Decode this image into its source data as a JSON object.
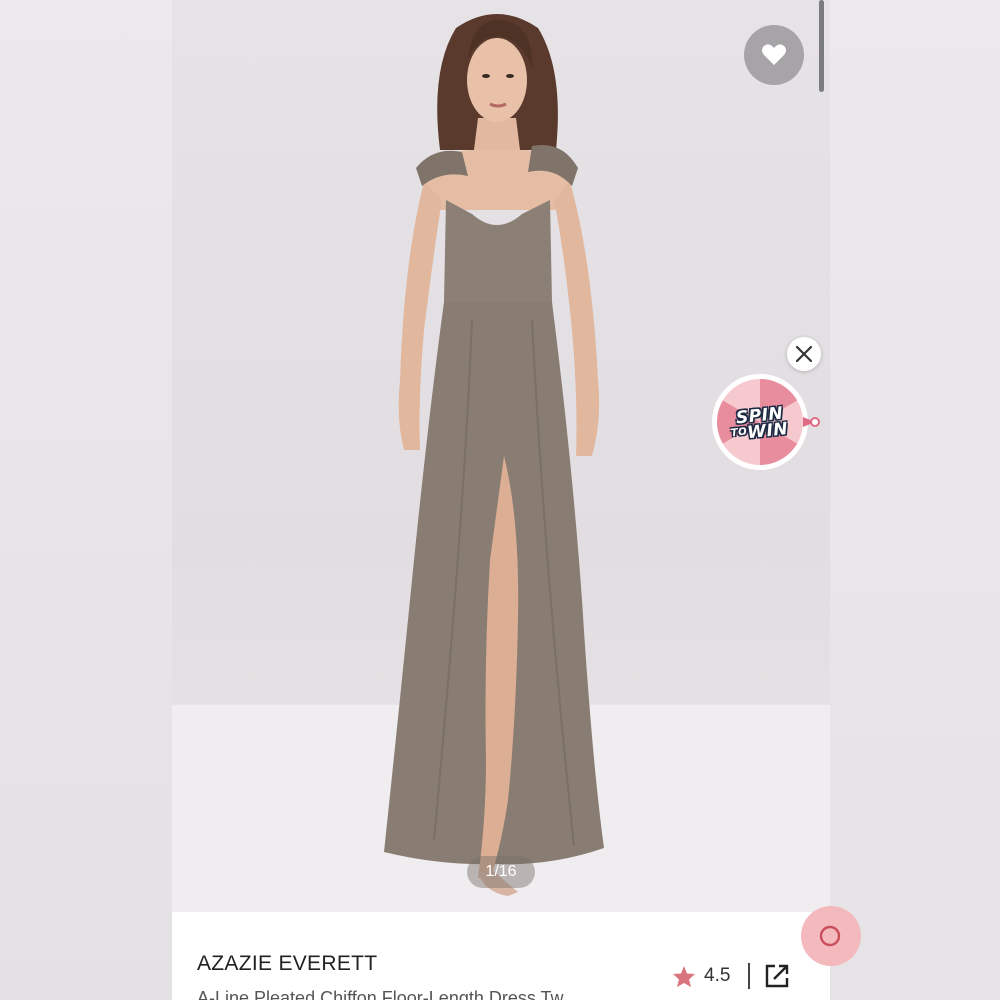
{
  "product": {
    "brand": "AZAZIE EVERETT",
    "subtitle": "A-Line Pleated Chiffon Floor-Length Dress Tw",
    "rating": "4.5"
  },
  "gallery": {
    "pager": "1/16"
  },
  "spin_to_win": {
    "word1": "SPIN",
    "word2_small": "TO",
    "word2": "WIN"
  },
  "icons": {
    "wishlist": "heart-icon",
    "close": "close-icon",
    "rating": "star-icon",
    "share": "external-link-icon"
  },
  "colors": {
    "dress": "#8a7e74",
    "wishlist_bg": "#a6a4a7",
    "star": "#d9737d",
    "spin_wheel": "#f0b4c0"
  }
}
